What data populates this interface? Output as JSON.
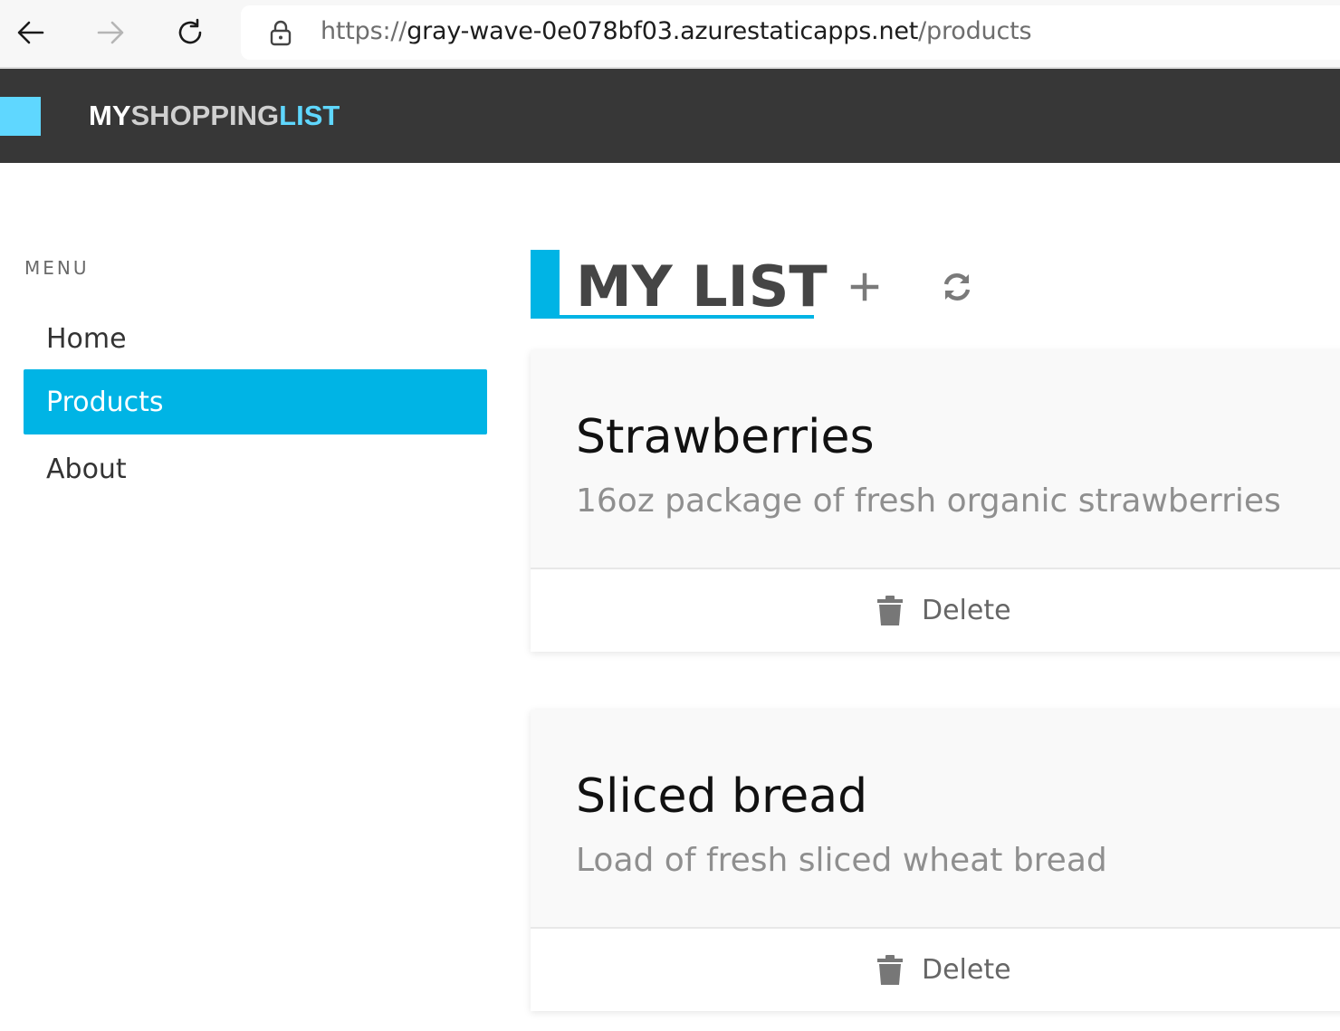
{
  "browser": {
    "url_scheme": "https://",
    "url_host": "gray-wave-0e078bf03.azurestaticapps.net",
    "url_path": "/products"
  },
  "header": {
    "brand_part1": "MY",
    "brand_part2": "SHOPPING",
    "brand_part3": "LIST",
    "colors": {
      "background": "#373737",
      "accent": "#5fd7ff"
    }
  },
  "sidebar": {
    "menu_label": "MENU",
    "items": [
      {
        "label": "Home",
        "active": false
      },
      {
        "label": "Products",
        "active": true
      },
      {
        "label": "About",
        "active": false
      }
    ],
    "active_color": "#00b4e5"
  },
  "main": {
    "title": "MY LIST",
    "add_icon": "plus-icon",
    "refresh_icon": "refresh-icon",
    "products": [
      {
        "name": "Strawberries",
        "description": "16oz package of fresh organic strawberries",
        "delete_label": "Delete"
      },
      {
        "name": "Sliced bread",
        "description": "Load of fresh sliced wheat bread",
        "delete_label": "Delete"
      }
    ]
  }
}
